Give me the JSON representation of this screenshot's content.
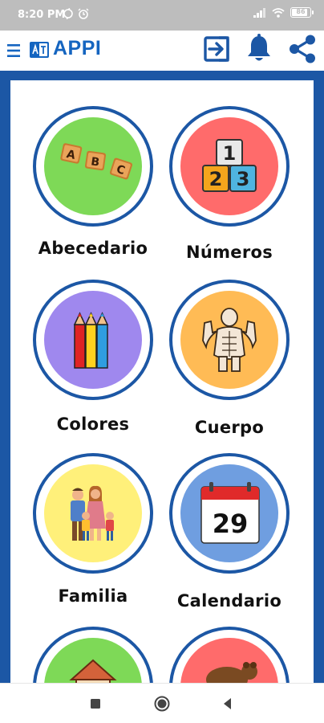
{
  "status_bar": {
    "time": "8:20 PM",
    "battery_level": 86
  },
  "app_bar": {
    "title": "APPI"
  },
  "categories": [
    {
      "label": "Abecedario",
      "icon": "abc-blocks-icon",
      "bg": "#7ed957",
      "blocks": [
        "A",
        "B",
        "C"
      ]
    },
    {
      "label": "Números",
      "icon": "number-blocks-icon",
      "bg": "#ff6b6b",
      "blocks": [
        "1",
        "2",
        "3"
      ]
    },
    {
      "label": "Colores",
      "icon": "colored-pencils-icon",
      "bg": "#9f88ee"
    },
    {
      "label": "Cuerpo",
      "icon": "muscle-body-icon",
      "bg": "#ffbb55"
    },
    {
      "label": "Familia",
      "icon": "family-icon",
      "bg": "#fff07a"
    },
    {
      "label": "Calendario",
      "icon": "calendar-icon",
      "bg": "#6f9ee0",
      "day": "29"
    },
    {
      "label": "",
      "icon": "house-icon",
      "bg": "#7ed957"
    },
    {
      "label": "",
      "icon": "animal-icon",
      "bg": "#ff6b6b"
    }
  ],
  "colors": {
    "brand_blue": "#1c57a5",
    "title_blue": "#1565c0"
  }
}
